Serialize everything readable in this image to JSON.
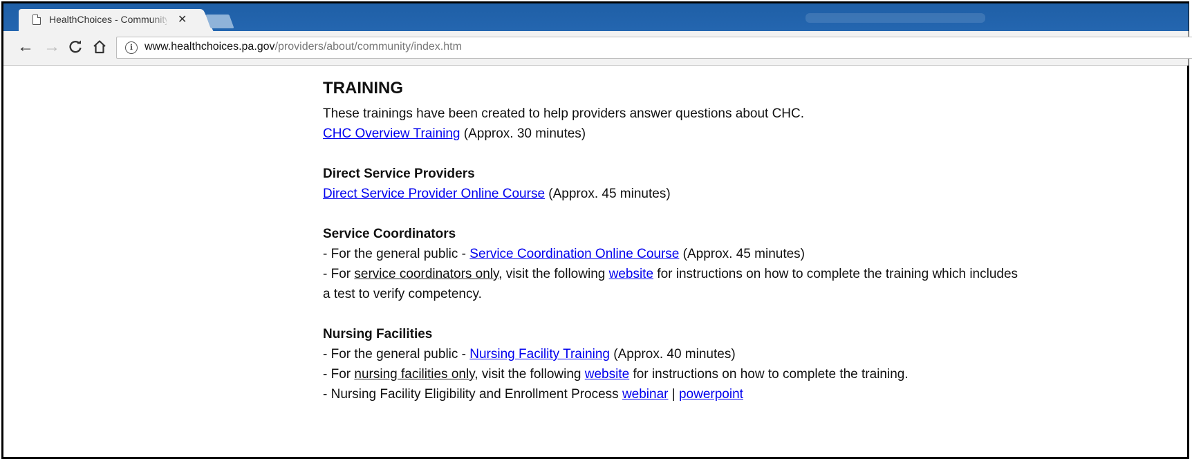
{
  "browser": {
    "tab_title": "HealthChoices - Community HealthChoices",
    "tab_close": "✕",
    "url_host": "www.healthchoices.pa.gov",
    "url_path": "/providers/about/community/index.htm",
    "nav": {
      "back": "←",
      "forward": "→",
      "reload": "C",
      "home": "⌂",
      "info": "i"
    },
    "colors": {
      "tabstrip": "#2466b0",
      "link": "#0000ee"
    }
  },
  "page": {
    "title": "TRAINING",
    "intro": "These trainings have been created to help providers answer questions about CHC.",
    "overview": {
      "link": "CHC Overview Training",
      "suffix": " (Approx. 30 minutes)"
    },
    "dsp": {
      "heading": "Direct Service Providers",
      "link": "Direct Service Provider Online Course",
      "suffix": " (Approx. 45 minutes)"
    },
    "sc": {
      "heading": "Service Coordinators",
      "l1_prefix": "- For the general public - ",
      "l1_link": "Service Coordination Online Course",
      "l1_suffix": " (Approx. 45 minutes)",
      "l2_prefix": "- For ",
      "l2_underlined": "service coordinators only,",
      "l2_mid": " visit the following ",
      "l2_link": "website",
      "l2_suffix": " for instructions on how to complete the training which includes",
      "l3": "a test to verify competency."
    },
    "nf": {
      "heading": "Nursing Facilities",
      "l1_prefix": "- For the general public - ",
      "l1_link": "Nursing Facility Training",
      "l1_suffix": " (Approx. 40 minutes)",
      "l2_prefix": "- For ",
      "l2_underlined": "nursing facilities only,",
      "l2_mid": " visit the following ",
      "l2_link": "website",
      "l2_suffix": " for instructions on how to complete the training.",
      "l3_prefix": "- Nursing Facility Eligibility and Enrollment Process ",
      "l3_link1": "webinar",
      "l3_sep": " | ",
      "l3_link2": "powerpoint"
    }
  }
}
